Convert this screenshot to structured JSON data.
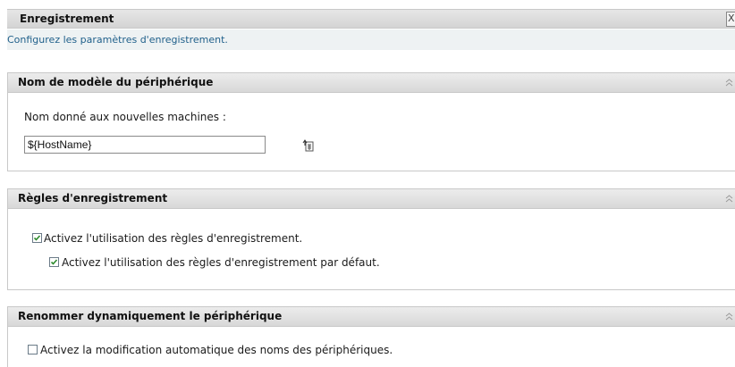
{
  "header": {
    "title": "Enregistrement",
    "description": "Configurez les paramètres d'enregistrement."
  },
  "panel_device_name": {
    "title": "Nom de modèle du périphérique",
    "field_label": "Nom donné aux nouvelles machines :",
    "field_value": "${HostName}"
  },
  "panel_rules": {
    "title": "Règles d'enregistrement",
    "checkbox_enable": {
      "label": "Activez l'utilisation des règles d'enregistrement.",
      "checked": true
    },
    "checkbox_default": {
      "label": "Activez l'utilisation des règles d'enregistrement par défaut.",
      "checked": true
    }
  },
  "panel_rename": {
    "title": "Renommer dynamiquement le périphérique",
    "checkbox_rename": {
      "label": "Activez la modification automatique des noms des périphériques.",
      "checked": false
    }
  },
  "colors": {
    "description_text": "#1f5f8a",
    "checkmark": "#2e8b2e"
  }
}
